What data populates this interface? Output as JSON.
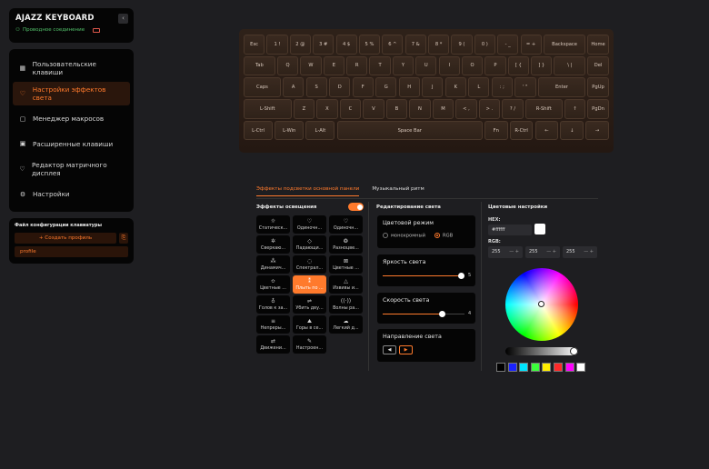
{
  "brand": {
    "title": "AJAZZ KEYBOARD",
    "status": "Проводное соединение"
  },
  "nav": {
    "items": [
      {
        "label": "Пользовательские клавиши",
        "icon": "grid-icon",
        "glyph": "▦"
      },
      {
        "label": "Настройки эффектов света",
        "icon": "bulb-icon",
        "glyph": "♡"
      },
      {
        "label": "Менеджер макросов",
        "icon": "macro-icon",
        "glyph": "▢"
      },
      {
        "label": "Расширенные клавиши",
        "icon": "advanced-key-icon",
        "glyph": "▣"
      },
      {
        "label": "Редактор матричного дисплея",
        "icon": "matrix-icon",
        "glyph": "♡"
      },
      {
        "label": "Настройки",
        "icon": "gear-icon",
        "glyph": "⚙"
      }
    ]
  },
  "config": {
    "title": "Файл конфигурации клавиатуры",
    "create_label": "+ Создать профиль",
    "profile": "profile"
  },
  "keyboard": {
    "rows": [
      [
        [
          "Esc",
          1
        ],
        [
          "1 !",
          1
        ],
        [
          "2 @",
          1
        ],
        [
          "3 #",
          1
        ],
        [
          "4 $",
          1
        ],
        [
          "5 %",
          1
        ],
        [
          "6 ^",
          1
        ],
        [
          "7 &",
          1
        ],
        [
          "8 *",
          1
        ],
        [
          "9 (",
          1
        ],
        [
          "0 )",
          1
        ],
        [
          "- _",
          1
        ],
        [
          "= +",
          1
        ],
        [
          "Backspace",
          2
        ],
        [
          "Home",
          1
        ]
      ],
      [
        [
          "Tab",
          1.5
        ],
        [
          "Q",
          1
        ],
        [
          "W",
          1
        ],
        [
          "E",
          1
        ],
        [
          "R",
          1
        ],
        [
          "T",
          1
        ],
        [
          "Y",
          1
        ],
        [
          "U",
          1
        ],
        [
          "I",
          1
        ],
        [
          "O",
          1
        ],
        [
          "P",
          1
        ],
        [
          "[ {",
          1
        ],
        [
          "] }",
          1
        ],
        [
          "\\ |",
          1.5
        ],
        [
          "Del",
          1
        ]
      ],
      [
        [
          "Caps",
          1.75
        ],
        [
          "A",
          1
        ],
        [
          "S",
          1
        ],
        [
          "D",
          1
        ],
        [
          "F",
          1
        ],
        [
          "G",
          1
        ],
        [
          "H",
          1
        ],
        [
          "J",
          1
        ],
        [
          "K",
          1
        ],
        [
          "L",
          1
        ],
        [
          ": ;",
          1
        ],
        [
          "' \"",
          1
        ],
        [
          "Enter",
          2.25
        ],
        [
          "PgUp",
          1
        ]
      ],
      [
        [
          "L-Shift",
          2.25
        ],
        [
          "Z",
          1
        ],
        [
          "X",
          1
        ],
        [
          "C",
          1
        ],
        [
          "V",
          1
        ],
        [
          "B",
          1
        ],
        [
          "N",
          1
        ],
        [
          "M",
          1
        ],
        [
          "< ,",
          1
        ],
        [
          "> .",
          1
        ],
        [
          "? /",
          1
        ],
        [
          "R-Shift",
          1.75
        ],
        [
          "↑",
          1
        ],
        [
          "PgDn",
          1
        ]
      ],
      [
        [
          "L-Ctrl",
          1.25
        ],
        [
          "L-Win",
          1.25
        ],
        [
          "L-Alt",
          1.25
        ],
        [
          "Space Bar",
          6.25
        ],
        [
          "Fn",
          1
        ],
        [
          "R-Ctrl",
          1
        ],
        [
          "←",
          1
        ],
        [
          "↓",
          1
        ],
        [
          "→",
          1
        ]
      ]
    ]
  },
  "tabs": [
    {
      "label": "Эффекты подсветки основной панели"
    },
    {
      "label": "Музыкальный ритм"
    }
  ],
  "effects": {
    "title": "Эффекты освещения",
    "items": [
      {
        "label": "Статическ...",
        "glyph": "☼"
      },
      {
        "label": "Одиночн...",
        "glyph": "♡"
      },
      {
        "label": "Одиночн...",
        "glyph": "♡"
      },
      {
        "label": "Сверкаю...",
        "glyph": "✲"
      },
      {
        "label": "Падающи...",
        "glyph": "◇"
      },
      {
        "label": "Разноцве...",
        "glyph": "❂"
      },
      {
        "label": "Динамич...",
        "glyph": "⁂"
      },
      {
        "label": "Спектрал...",
        "glyph": "◌"
      },
      {
        "label": "Цветные ...",
        "glyph": "⊠"
      },
      {
        "label": "Цветные ...",
        "glyph": "≎"
      },
      {
        "label": "Плыть по ...",
        "glyph": "⁑"
      },
      {
        "label": "Извивы и...",
        "glyph": "△"
      },
      {
        "label": "Голов к за...",
        "glyph": "♁"
      },
      {
        "label": "Убить дву...",
        "glyph": "⇌"
      },
      {
        "label": "Волны ра...",
        "glyph": "((·))"
      },
      {
        "label": "Непреры...",
        "glyph": "≡"
      },
      {
        "label": "Горы в се...",
        "glyph": "⛰"
      },
      {
        "label": "Легкий д...",
        "glyph": "☁"
      },
      {
        "label": "Движени...",
        "glyph": "⇄"
      },
      {
        "label": "Настроен...",
        "glyph": "✎"
      }
    ]
  },
  "light_edit": {
    "title": "Редактирование света",
    "color_mode": {
      "title": "Цветовой режим",
      "mono": "монохромный",
      "rgb": "RGB"
    },
    "brightness": {
      "title": "Яркость света",
      "value": "5",
      "fraction": 0.96
    },
    "speed": {
      "title": "Скорость света",
      "value": "4",
      "fraction": 0.73
    },
    "direction": {
      "title": "Направление света",
      "left": "◀",
      "right": "▶"
    }
  },
  "color": {
    "title": "Цветовые настройки",
    "hex_label": "HEX:",
    "hex": "#ffffff",
    "rgb_label": "RGB:",
    "r": "255",
    "g": "255",
    "b": "255",
    "presets": [
      "#000000",
      "#1b22ff",
      "#00e5ff",
      "#3cff3c",
      "#ffee00",
      "#ff2a2a",
      "#ff00ff",
      "#ffffff"
    ]
  }
}
